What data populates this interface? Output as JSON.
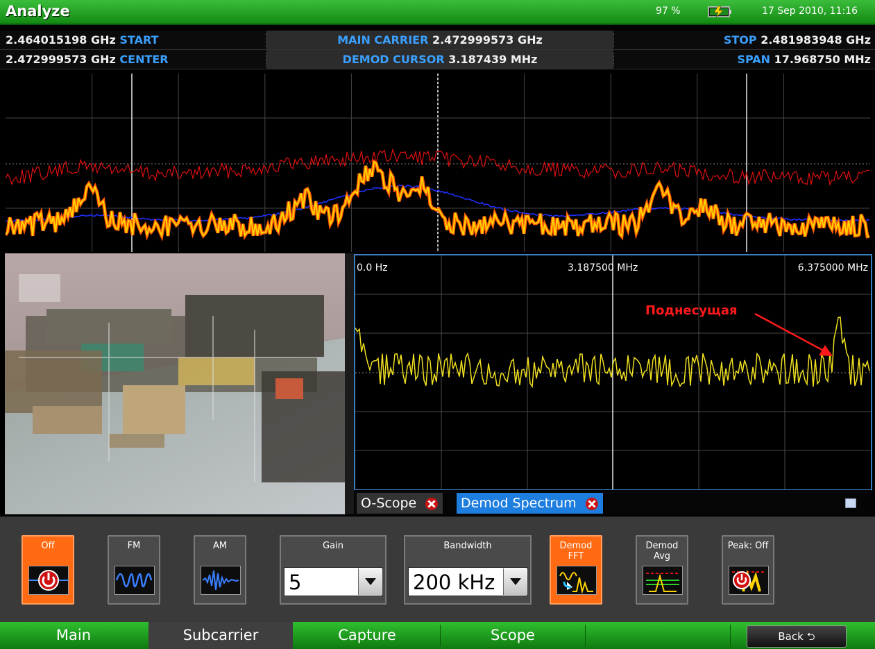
{
  "header": {
    "title": "Analyze",
    "battery_percent": "97 %",
    "datetime": "17 Sep 2010, 11:16"
  },
  "info": {
    "start_value": "2.464015198 GHz",
    "start_label": "START",
    "main_carrier_label": "MAIN CARRIER",
    "main_carrier_value": "2.472999573 GHz",
    "stop_label": "STOP",
    "stop_value": "2.481983948 GHz",
    "center_value": "2.472999573 GHz",
    "center_label": "CENTER",
    "demod_cursor_label": "DEMOD CURSOR",
    "demod_cursor_value": "3.187439 MHz",
    "span_label": "SPAN",
    "span_value": "17.968750 MHz"
  },
  "demod_panel": {
    "freq_start": "0.0 Hz",
    "freq_mid": "3.187500 MHz",
    "freq_end": "6.375000 MHz",
    "annotation": "Поднесущая"
  },
  "panel_tabs": [
    {
      "label": "O-Scope"
    },
    {
      "label": "Demod Spectrum"
    }
  ],
  "controls": {
    "off_label": "Off",
    "fm_label": "FM",
    "am_label": "AM",
    "gain_label": "Gain",
    "gain_value": "5",
    "bandwidth_label": "Bandwidth",
    "bandwidth_value": "200 kHz",
    "demod_fft_label": "Demod FFT",
    "demod_avg_label": "Demod Avg",
    "peak_label": "Peak: Off"
  },
  "bottom_tabs": [
    {
      "label": "Main"
    },
    {
      "label": "Subcarrier"
    },
    {
      "label": "Capture"
    },
    {
      "label": "Scope"
    }
  ],
  "back_label": "Back ⮌",
  "colors": {
    "accent_green": "#1ea01e",
    "active_orange": "#ff6a12",
    "label_blue": "#3aa0ff",
    "tab_blue": "#1d7ee0",
    "trace_red": "#e01010",
    "trace_blue": "#2030ff",
    "trace_yellow": "#ffd400",
    "trace_orange": "#ff5a00",
    "annotation_red": "#ff1a1a"
  },
  "icons": [
    "battery-charging-icon",
    "close-icon",
    "panel-menu-icon",
    "power-icon",
    "fm-wave-icon",
    "am-wave-icon",
    "demod-fft-icon",
    "demod-avg-icon",
    "peak-icon"
  ]
}
